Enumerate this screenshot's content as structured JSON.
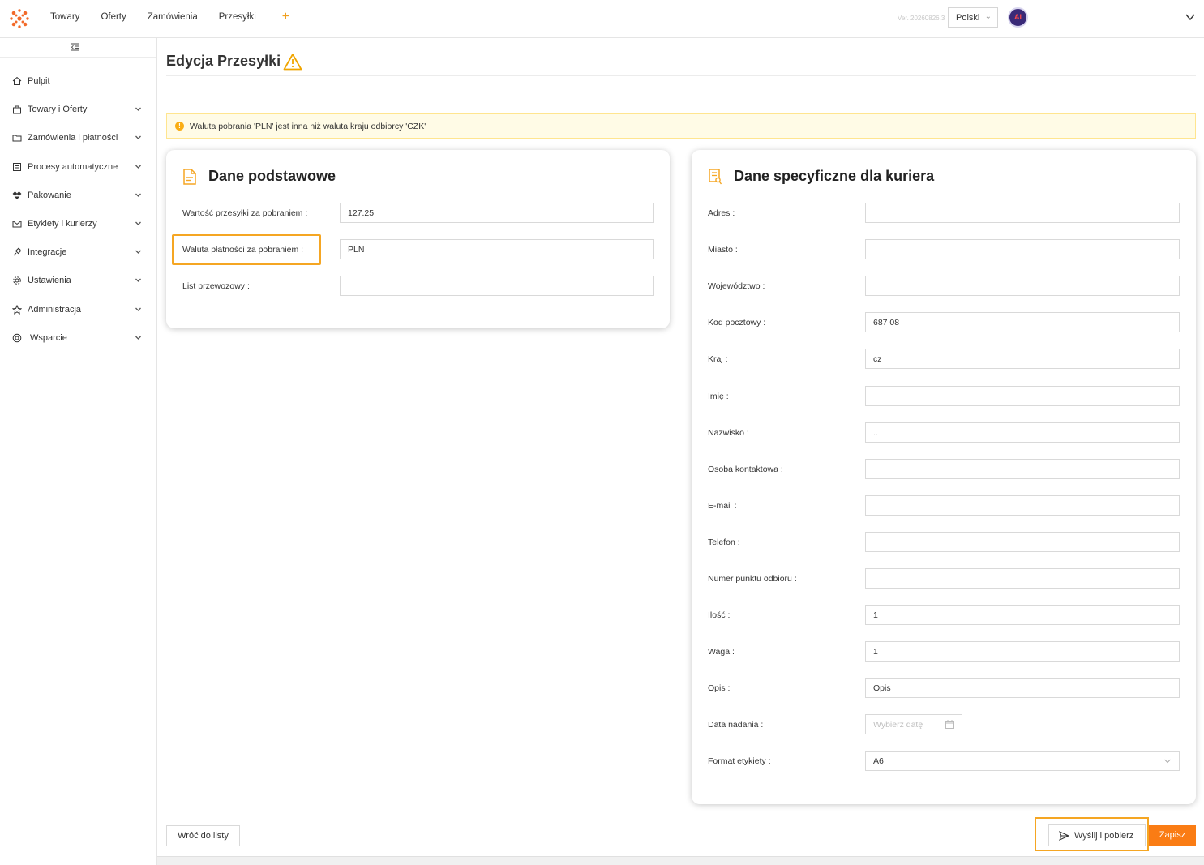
{
  "topbar": {
    "nav": [
      "Towary",
      "Oferty",
      "Zamówienia",
      "Przesyłki"
    ],
    "plus": "+",
    "version": "Ver. 20260826.3",
    "language": "Polski",
    "avatar_text": "Ai"
  },
  "sidebar": {
    "items": [
      {
        "label": "Pulpit",
        "icon": "home-icon",
        "expandable": false
      },
      {
        "label": "Towary i Oferty",
        "icon": "bag-icon",
        "expandable": true
      },
      {
        "label": "Zamówienia i płatności",
        "icon": "folder-icon",
        "expandable": true
      },
      {
        "label": "Procesy automatyczne",
        "icon": "process-icon",
        "expandable": true
      },
      {
        "label": "Pakowanie",
        "icon": "box-icon",
        "expandable": true
      },
      {
        "label": "Etykiety i kurierzy",
        "icon": "mail-icon",
        "expandable": true
      },
      {
        "label": "Integracje",
        "icon": "plug-icon",
        "expandable": true
      },
      {
        "label": "Ustawienia",
        "icon": "gear-icon",
        "expandable": true
      },
      {
        "label": "Administracja",
        "icon": "admin-icon",
        "expandable": true
      },
      {
        "label": "Wsparcie",
        "icon": "support-icon",
        "expandable": true
      }
    ]
  },
  "page": {
    "title": "Edycja Przesyłki",
    "alert": "Waluta pobrania 'PLN' jest inna niż waluta kraju odbiorcy 'CZK'"
  },
  "basic": {
    "title": "Dane podstawowe",
    "fields": [
      {
        "label": "Wartość przesyłki za pobraniem",
        "value": "127.25"
      },
      {
        "label": "Waluta płatności za pobraniem",
        "value": "PLN"
      },
      {
        "label": "List przewozowy",
        "value": ""
      }
    ]
  },
  "courier": {
    "title": "Dane specyficzne dla kuriera",
    "fields": [
      {
        "label": "Adres",
        "value": ""
      },
      {
        "label": "Miasto",
        "value": ""
      },
      {
        "label": "Województwo",
        "value": ""
      },
      {
        "label": "Kod pocztowy",
        "value": "687 08"
      },
      {
        "label": "Kraj",
        "value": "cz"
      },
      {
        "label": "Imię",
        "value": ""
      },
      {
        "label": "Nazwisko",
        "value": ".."
      },
      {
        "label": "Osoba kontaktowa",
        "value": ""
      },
      {
        "label": "E-mail",
        "value": ""
      },
      {
        "label": "Telefon",
        "value": ""
      },
      {
        "label": "Numer punktu odbioru",
        "value": ""
      },
      {
        "label": "Ilość",
        "value": "1"
      },
      {
        "label": "Waga",
        "value": "1"
      },
      {
        "label": "Opis",
        "value": "Opis"
      }
    ],
    "date_label": "Data nadania",
    "date_placeholder": "Wybierz datę",
    "format_label": "Format etykiety",
    "format_value": "A6"
  },
  "footer": {
    "back": "Wróć do listy",
    "send": "Wyślij i pobierz",
    "save": "Zapisz"
  },
  "colors": {
    "accent": "#fa7c14",
    "highlight": "#f5a623",
    "alert_bg": "#fffbe6"
  }
}
